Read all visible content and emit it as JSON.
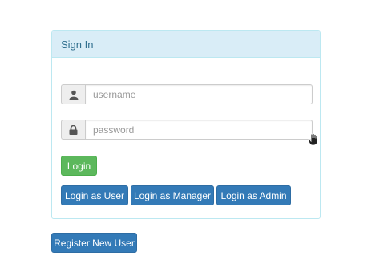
{
  "panel": {
    "heading": "Sign In"
  },
  "username": {
    "icon": "user-icon",
    "placeholder": "username",
    "value": ""
  },
  "password": {
    "icon": "lock-icon",
    "placeholder": "password",
    "value": ""
  },
  "buttons": {
    "login": "Login",
    "login_user": "Login as User",
    "login_manager": "Login as Manager",
    "login_admin": "Login as Admin",
    "register": "Register New User"
  },
  "colors": {
    "panel_heading_bg": "#d9edf7",
    "panel_heading_text": "#31708f",
    "success": "#5cb85c",
    "primary": "#337ab7"
  }
}
